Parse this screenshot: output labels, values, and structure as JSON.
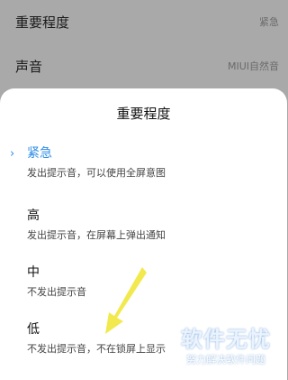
{
  "settings": {
    "rows": [
      {
        "label": "重要程度",
        "value": "紧急"
      },
      {
        "label": "声音",
        "value": "MIUI自然音"
      }
    ]
  },
  "dialog": {
    "title": "重要程度",
    "options": [
      {
        "title": "紧急",
        "desc": "发出提示音，可以使用全屏意图",
        "selected": true
      },
      {
        "title": "高",
        "desc": "发出提示音，在屏幕上弹出通知",
        "selected": false
      },
      {
        "title": "中",
        "desc": "不发出提示音",
        "selected": false
      },
      {
        "title": "低",
        "desc": "不发出提示音，不在锁屏上显示",
        "selected": false
      }
    ],
    "selected_marker": "›"
  },
  "watermark": {
    "main": "软件无忧",
    "sub": "努力解决软件问题"
  },
  "colors": {
    "accent": "#2f8ee7",
    "annotation_arrow": "#f2e94e",
    "overlay": "#a9a9a9"
  }
}
